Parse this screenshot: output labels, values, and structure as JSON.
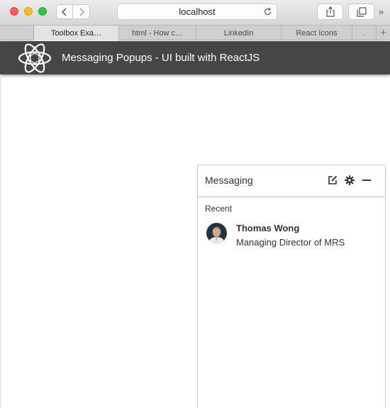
{
  "browser": {
    "url": "localhost",
    "tabs": [
      {
        "label": "Toolbox Exa…",
        "active": true
      },
      {
        "label": "html - How c…",
        "active": false
      },
      {
        "label": "LinkedIn",
        "active": false
      },
      {
        "label": "React Icons",
        "active": false
      },
      {
        "label": ".",
        "active": false
      }
    ],
    "new_tab_label": "+",
    "overflow_label": "»"
  },
  "app": {
    "title": "Messaging Popups - UI built with ReactJS",
    "header_color": "#464646",
    "logo_icon": "react-atom-icon"
  },
  "messaging": {
    "title": "Messaging",
    "icons": [
      "compose-icon",
      "gear-icon",
      "minimize-icon"
    ],
    "section_label": "Recent",
    "contacts": [
      {
        "name": "Thomas Wong",
        "role": "Managing Director of MRS",
        "avatar": "avatar-photo"
      }
    ]
  }
}
